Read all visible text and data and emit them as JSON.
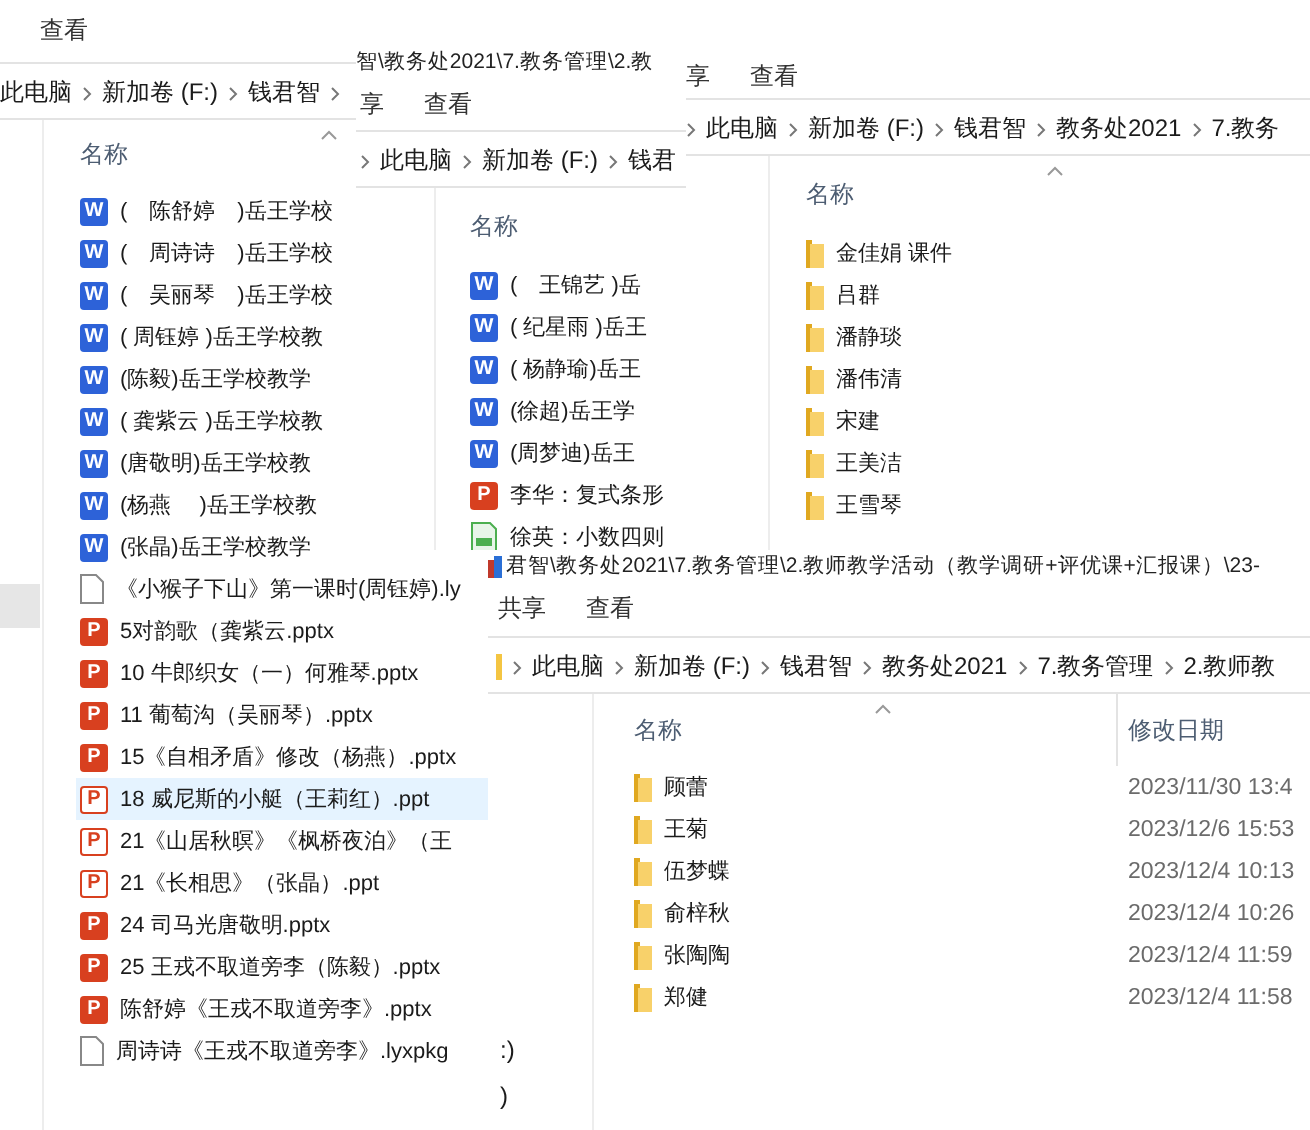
{
  "windows": [
    {
      "ribbon_tabs": [
        "查看"
      ],
      "breadcrumb": {
        "items": [
          "此电脑",
          "新加卷 (F:)",
          "钱君智"
        ],
        "trailing_chevron": true
      },
      "nav_selection": true,
      "columns": [
        {
          "label": "名称",
          "sorted": true
        }
      ],
      "rows": [
        {
          "kind": "word",
          "badge": "W",
          "name": "(　陈舒婷　)岳王学校",
          "selected": false
        },
        {
          "kind": "word",
          "badge": "W",
          "name": "(　周诗诗　)岳王学校",
          "selected": false
        },
        {
          "kind": "word",
          "badge": "W",
          "name": "(　吴丽琴　)岳王学校",
          "selected": false
        },
        {
          "kind": "word",
          "badge": "W",
          "name": "( 周钰婷 )岳王学校教",
          "selected": false
        },
        {
          "kind": "word",
          "badge": "W",
          "name": "(陈毅)岳王学校教学",
          "selected": false
        },
        {
          "kind": "word",
          "badge": "W",
          "name": "( 龚紫云 )岳王学校教",
          "selected": false
        },
        {
          "kind": "word",
          "badge": "W",
          "name": "(唐敬明)岳王学校教",
          "selected": false
        },
        {
          "kind": "word",
          "badge": "W",
          "name": "(杨燕　 )岳王学校教",
          "selected": false
        },
        {
          "kind": "word",
          "badge": "W",
          "name": "(张晶)岳王学校教学",
          "selected": false
        },
        {
          "kind": "file",
          "name": "《小猴子下山》第一课时(周钰婷).ly",
          "selected": false
        },
        {
          "kind": "slides",
          "badge": "P",
          "name": "5对韵歌（龚紫云.pptx",
          "selected": false
        },
        {
          "kind": "slides",
          "badge": "P",
          "name": "10 牛郎织女（一）何雅琴.pptx",
          "selected": false
        },
        {
          "kind": "slides",
          "badge": "P",
          "name": "11 葡萄沟（吴丽琴）.pptx",
          "selected": false
        },
        {
          "kind": "slides",
          "badge": "P",
          "name": "15《自相矛盾》修改（杨燕）.pptx",
          "selected": false
        },
        {
          "kind": "slides-old",
          "badge": "P",
          "name": "18 威尼斯的小艇（王莉红）.ppt",
          "selected": true
        },
        {
          "kind": "slides-old",
          "badge": "P",
          "name": "21《山居秋暝》《枫桥夜泊》（王",
          "selected": false
        },
        {
          "kind": "slides-old",
          "badge": "P",
          "name": "21《长相思》（张晶）.ppt",
          "selected": false
        },
        {
          "kind": "slides",
          "badge": "P",
          "name": "24 司马光唐敬明.pptx",
          "selected": false
        },
        {
          "kind": "slides",
          "badge": "P",
          "name": "25 王戎不取道旁李（陈毅）.pptx",
          "selected": false
        },
        {
          "kind": "slides",
          "badge": "P",
          "name": "陈舒婷《王戎不取道旁李》.pptx",
          "selected": false
        },
        {
          "kind": "file",
          "name": "周诗诗《王戎不取道旁李》.lyxpkg",
          "selected": false
        }
      ]
    },
    {
      "title": "智\\教务处2021\\7.教务管理\\2.教",
      "ribbon_tabs": [
        "享",
        "查看"
      ],
      "breadcrumb": {
        "leading_chevron": true,
        "items": [
          "此电脑",
          "新加卷 (F:)",
          "钱君"
        ]
      },
      "columns": [
        {
          "label": "名称"
        }
      ],
      "rows": [
        {
          "kind": "word",
          "badge": "W",
          "name": "(　王锦艺 )岳",
          "selected": false
        },
        {
          "kind": "word",
          "badge": "W",
          "name": "( 纪星雨 )岳王",
          "selected": false
        },
        {
          "kind": "word",
          "badge": "W",
          "name": "( 杨静瑜)岳王",
          "selected": false
        },
        {
          "kind": "word",
          "badge": "W",
          "name": "(徐超)岳王学",
          "selected": false
        },
        {
          "kind": "word",
          "badge": "W",
          "name": "(周梦迪)岳王",
          "selected": false
        },
        {
          "kind": "slides",
          "badge": "P",
          "name": "李华：复式条形",
          "selected": false
        },
        {
          "kind": "sheet",
          "name": "徐英：小数四则",
          "selected": false
        }
      ]
    },
    {
      "ribbon_tabs": [
        "享",
        "查看"
      ],
      "breadcrumb": {
        "leading_chevron": true,
        "items": [
          "此电脑",
          "新加卷 (F:)",
          "钱君智",
          "教务处2021",
          "7.教务"
        ]
      },
      "columns": [
        {
          "label": "名称",
          "sorted": true
        }
      ],
      "rows": [
        {
          "kind": "folder",
          "name": "金佳娟 课件",
          "selected": false
        },
        {
          "kind": "folder",
          "name": "吕群",
          "selected": false
        },
        {
          "kind": "folder",
          "name": "潘静琰",
          "selected": false
        },
        {
          "kind": "folder",
          "name": "潘伟清",
          "selected": false
        },
        {
          "kind": "folder",
          "name": "宋建",
          "selected": false
        },
        {
          "kind": "folder",
          "name": "王美洁",
          "selected": false
        },
        {
          "kind": "folder",
          "name": "王雪琴",
          "selected": false
        }
      ]
    },
    {
      "title": "君智\\教务处2021\\7.教务管理\\2.教师教学活动（教学调研+评优课+汇报课）\\23-",
      "title_icon": true,
      "ribbon_tabs": [
        "共享",
        "查看"
      ],
      "breadcrumb": {
        "leading_chevron": true,
        "location_icon": true,
        "items": [
          "此电脑",
          "新加卷 (F:)",
          "钱君智",
          "教务处2021",
          "7.教务管理",
          "2.教师教"
        ]
      },
      "nav_items": [
        ":)",
        ")"
      ],
      "columns": [
        {
          "label": "名称",
          "sorted": true
        },
        {
          "label": "修改日期"
        }
      ],
      "rows": [
        {
          "kind": "folder",
          "name": "顾蕾",
          "date": "2023/11/30 13:4",
          "selected": false
        },
        {
          "kind": "folder",
          "name": "王菊",
          "date": "2023/12/6 15:53",
          "selected": false
        },
        {
          "kind": "folder",
          "name": "伍梦蝶",
          "date": "2023/12/4 10:13",
          "selected": false
        },
        {
          "kind": "folder",
          "name": "俞梓秋",
          "date": "2023/12/4 10:26",
          "selected": false
        },
        {
          "kind": "folder",
          "name": "张陶陶",
          "date": "2023/12/4 11:59",
          "selected": false
        },
        {
          "kind": "folder",
          "name": "郑健",
          "date": "2023/12/4 11:58",
          "selected": false
        }
      ]
    }
  ]
}
